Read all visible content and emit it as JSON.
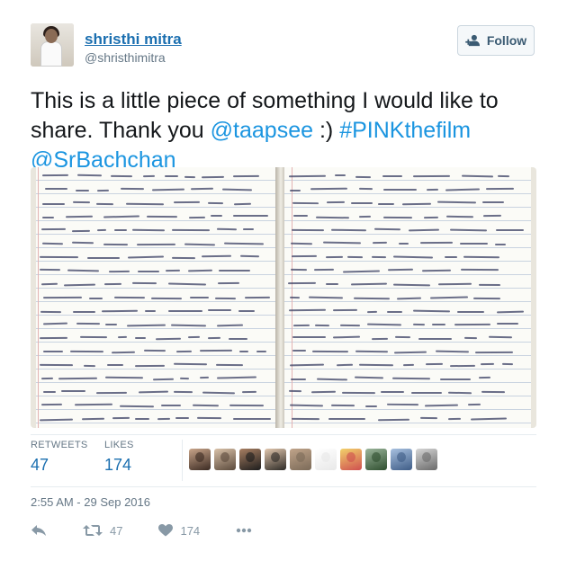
{
  "user": {
    "name": "shristhi mitra",
    "handle": "@shristhimitra"
  },
  "follow_button": {
    "label": "Follow"
  },
  "tweet": {
    "text_parts": [
      {
        "t": "This is a little piece of something I would like to share. Thank you ",
        "link": false
      },
      {
        "t": "@taapsee",
        "link": true
      },
      {
        "t": " :) ",
        "link": false
      },
      {
        "t": "#PINKthefilm",
        "link": true
      },
      {
        "t": " ",
        "link": false
      },
      {
        "t": "@SrBachchan",
        "link": true
      }
    ]
  },
  "stats": {
    "retweets_label": "RETWEETS",
    "retweets_value": "47",
    "likes_label": "LIKES",
    "likes_value": "174"
  },
  "timestamp": "2:55 AM - 29 Sep 2016",
  "actions": {
    "retweet_count": "47",
    "like_count": "174"
  },
  "icons": [
    "follow-user-icon",
    "reply-icon",
    "retweet-icon",
    "like-icon",
    "more-icon"
  ],
  "colors": {
    "link": "#1b95e0",
    "name": "#1b6fb0",
    "muted": "#657786",
    "ink": "#3a3f63"
  }
}
